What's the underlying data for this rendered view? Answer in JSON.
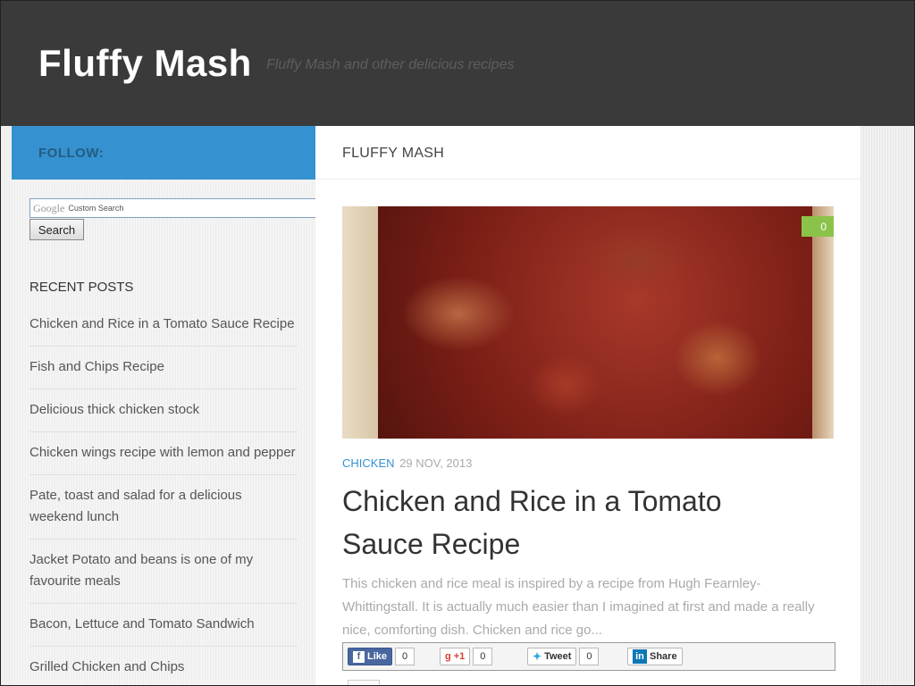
{
  "header": {
    "site_title": "Fluffy Mash",
    "tagline": "Fluffy Mash and other delicious recipes"
  },
  "sidebar": {
    "follow_label": "FOLLOW:",
    "search": {
      "brand": "Google",
      "placeholder": "Custom Search",
      "button_label": "Search"
    },
    "recent_heading": "RECENT POSTS",
    "recent_posts": [
      "Chicken and Rice in a Tomato Sauce Recipe",
      "Fish and Chips Recipe",
      "Delicious thick chicken stock",
      "Chicken wings recipe with lemon and pepper",
      "Pate, toast and salad for a delicious weekend lunch",
      "Jacket Potato and beans is one of my favourite meals",
      "Bacon, Lettuce and Tomato Sandwich",
      "Grilled Chicken and Chips"
    ]
  },
  "main": {
    "section_title": "FLUFFY MASH",
    "post": {
      "comment_count": "0",
      "category": "CHICKEN",
      "date": "29 NOV, 2013",
      "title": "Chicken and Rice in a Tomato Sauce Recipe",
      "excerpt": "This chicken and rice meal is inspired by a recipe from Hugh Fearnley-Whittingstall. It is actually much easier than I imagined at first and made a really nice, comforting dish. Chicken and rice go..."
    },
    "share": {
      "facebook_label": "Like",
      "facebook_count": "0",
      "gplus_label": "+1",
      "gplus_count": "0",
      "twitter_label": "Tweet",
      "twitter_count": "0",
      "linkedin_label": "Share"
    }
  },
  "colors": {
    "header_bg": "#3a3a3a",
    "accent_blue": "#3591cf",
    "badge_green": "#8bc34a"
  }
}
